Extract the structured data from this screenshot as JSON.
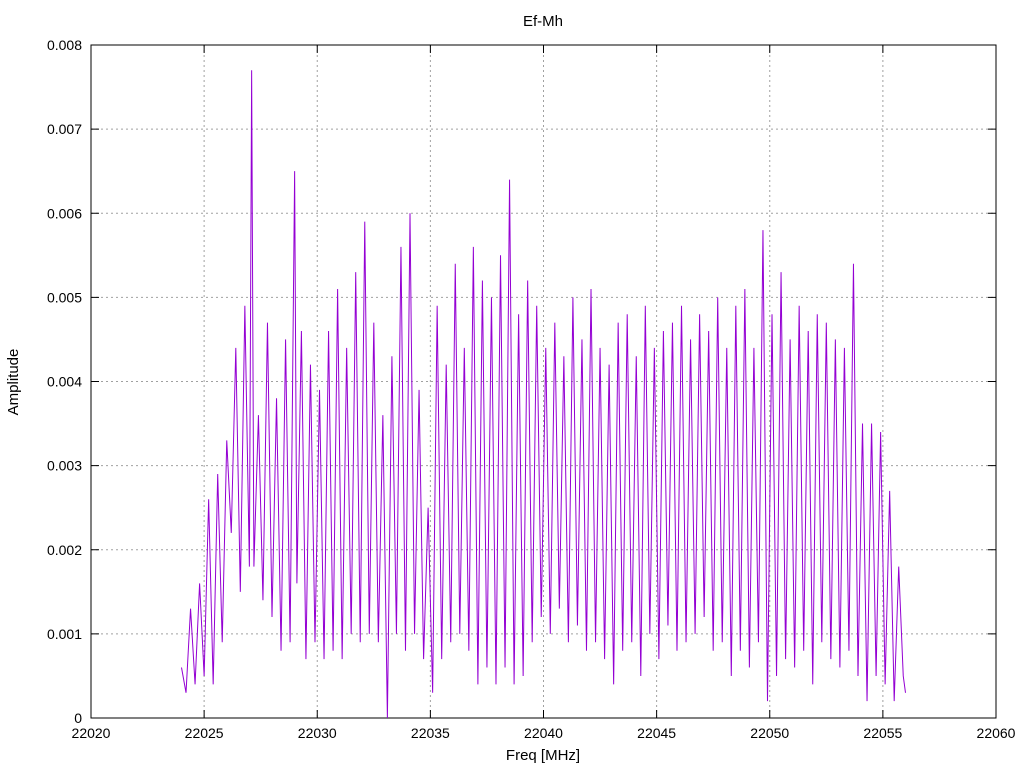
{
  "chart_data": {
    "type": "line",
    "title": "Ef-Mh",
    "xlabel": "Freq [MHz]",
    "ylabel": "Amplitude",
    "xlim": [
      22020,
      22060
    ],
    "ylim": [
      0,
      0.008
    ],
    "xticks": [
      22020,
      22025,
      22030,
      22035,
      22040,
      22045,
      22050,
      22055,
      22060
    ],
    "yticks": [
      0,
      0.001,
      0.002,
      0.003,
      0.004,
      0.005,
      0.006,
      0.007,
      0.008
    ],
    "xtick_labels": [
      "22020",
      "22025",
      "22030",
      "22035",
      "22040",
      "22045",
      "22050",
      "22055",
      "22060"
    ],
    "ytick_labels": [
      "0",
      "0.001",
      "0.002",
      "0.003",
      "0.004",
      "0.005",
      "0.006",
      "0.007",
      "0.008"
    ],
    "grid": true,
    "line_color": "#9400d3",
    "series": [
      {
        "x": [
          22024.0,
          22024.2,
          22024.4,
          22024.6,
          22024.8,
          22025.0,
          22025.2,
          22025.4,
          22025.6,
          22025.8,
          22026.0,
          22026.2,
          22026.4,
          22026.6,
          22026.8,
          22027.0,
          22027.1,
          22027.2,
          22027.4,
          22027.6,
          22027.8,
          22028.0,
          22028.2,
          22028.4,
          22028.6,
          22028.8,
          22029.0,
          22029.1,
          22029.3,
          22029.5,
          22029.7,
          22029.9,
          22030.1,
          22030.3,
          22030.5,
          22030.7,
          22030.9,
          22031.1,
          22031.3,
          22031.5,
          22031.7,
          22031.9,
          22032.1,
          22032.3,
          22032.5,
          22032.7,
          22032.9,
          22033.1,
          22033.3,
          22033.5,
          22033.7,
          22033.9,
          22034.1,
          22034.3,
          22034.5,
          22034.7,
          22034.9,
          22035.1,
          22035.3,
          22035.5,
          22035.7,
          22035.9,
          22036.1,
          22036.3,
          22036.5,
          22036.7,
          22036.9,
          22037.1,
          22037.3,
          22037.5,
          22037.7,
          22037.9,
          22038.1,
          22038.3,
          22038.5,
          22038.7,
          22038.9,
          22039.1,
          22039.3,
          22039.5,
          22039.7,
          22039.9,
          22040.1,
          22040.3,
          22040.5,
          22040.7,
          22040.9,
          22041.1,
          22041.3,
          22041.5,
          22041.7,
          22041.9,
          22042.1,
          22042.3,
          22042.5,
          22042.7,
          22042.9,
          22043.1,
          22043.3,
          22043.5,
          22043.7,
          22043.9,
          22044.1,
          22044.3,
          22044.5,
          22044.7,
          22044.9,
          22045.1,
          22045.3,
          22045.5,
          22045.7,
          22045.9,
          22046.1,
          22046.3,
          22046.5,
          22046.7,
          22046.9,
          22047.1,
          22047.3,
          22047.5,
          22047.7,
          22047.9,
          22048.1,
          22048.3,
          22048.5,
          22048.7,
          22048.9,
          22049.1,
          22049.3,
          22049.5,
          22049.7,
          22049.9,
          22050.1,
          22050.3,
          22050.5,
          22050.7,
          22050.9,
          22051.1,
          22051.3,
          22051.5,
          22051.7,
          22051.9,
          22052.1,
          22052.3,
          22052.5,
          22052.7,
          22052.9,
          22053.1,
          22053.3,
          22053.5,
          22053.7,
          22053.9,
          22054.1,
          22054.3,
          22054.5,
          22054.7,
          22054.9,
          22055.1,
          22055.3,
          22055.5,
          22055.7,
          22055.9,
          22056.0
        ],
        "y": [
          0.0006,
          0.0003,
          0.0013,
          0.0004,
          0.0016,
          0.0005,
          0.0026,
          0.0004,
          0.0029,
          0.0009,
          0.0033,
          0.0022,
          0.0044,
          0.0015,
          0.0049,
          0.0018,
          0.0077,
          0.0018,
          0.0036,
          0.0014,
          0.0047,
          0.0012,
          0.0038,
          0.0008,
          0.0045,
          0.0009,
          0.0065,
          0.0016,
          0.0046,
          0.0007,
          0.0042,
          0.0009,
          0.0039,
          0.0007,
          0.0046,
          0.0008,
          0.0051,
          0.0007,
          0.0044,
          0.001,
          0.0053,
          0.0009,
          0.0059,
          0.001,
          0.0047,
          0.0009,
          0.0036,
          0.0,
          0.0043,
          0.001,
          0.0056,
          0.0008,
          0.006,
          0.001,
          0.0039,
          0.0007,
          0.0025,
          0.0003,
          0.0049,
          0.0007,
          0.0042,
          0.0009,
          0.0054,
          0.001,
          0.0044,
          0.0008,
          0.0056,
          0.0004,
          0.0052,
          0.0006,
          0.005,
          0.0004,
          0.0055,
          0.0006,
          0.0064,
          0.0004,
          0.0048,
          0.0005,
          0.0052,
          0.0009,
          0.0049,
          0.0012,
          0.0044,
          0.001,
          0.0047,
          0.0013,
          0.0043,
          0.0009,
          0.005,
          0.0011,
          0.0045,
          0.0008,
          0.0051,
          0.0009,
          0.0044,
          0.0007,
          0.0042,
          0.0004,
          0.0047,
          0.0008,
          0.0048,
          0.0009,
          0.0043,
          0.0005,
          0.0049,
          0.001,
          0.0044,
          0.0007,
          0.0046,
          0.0011,
          0.0047,
          0.0008,
          0.0049,
          0.0009,
          0.0045,
          0.001,
          0.0048,
          0.0012,
          0.0046,
          0.0008,
          0.005,
          0.0009,
          0.0044,
          0.0005,
          0.0049,
          0.0008,
          0.0051,
          0.0006,
          0.0044,
          0.0009,
          0.0058,
          0.0002,
          0.0048,
          0.0005,
          0.0053,
          0.0007,
          0.0045,
          0.0006,
          0.0049,
          0.0008,
          0.0046,
          0.0004,
          0.0048,
          0.0009,
          0.0047,
          0.0007,
          0.0045,
          0.0006,
          0.0044,
          0.0008,
          0.0054,
          0.0005,
          0.0035,
          0.0002,
          0.0035,
          0.0005,
          0.0034,
          0.0004,
          0.0027,
          0.0002,
          0.0018,
          0.0005,
          0.0003
        ]
      }
    ]
  }
}
